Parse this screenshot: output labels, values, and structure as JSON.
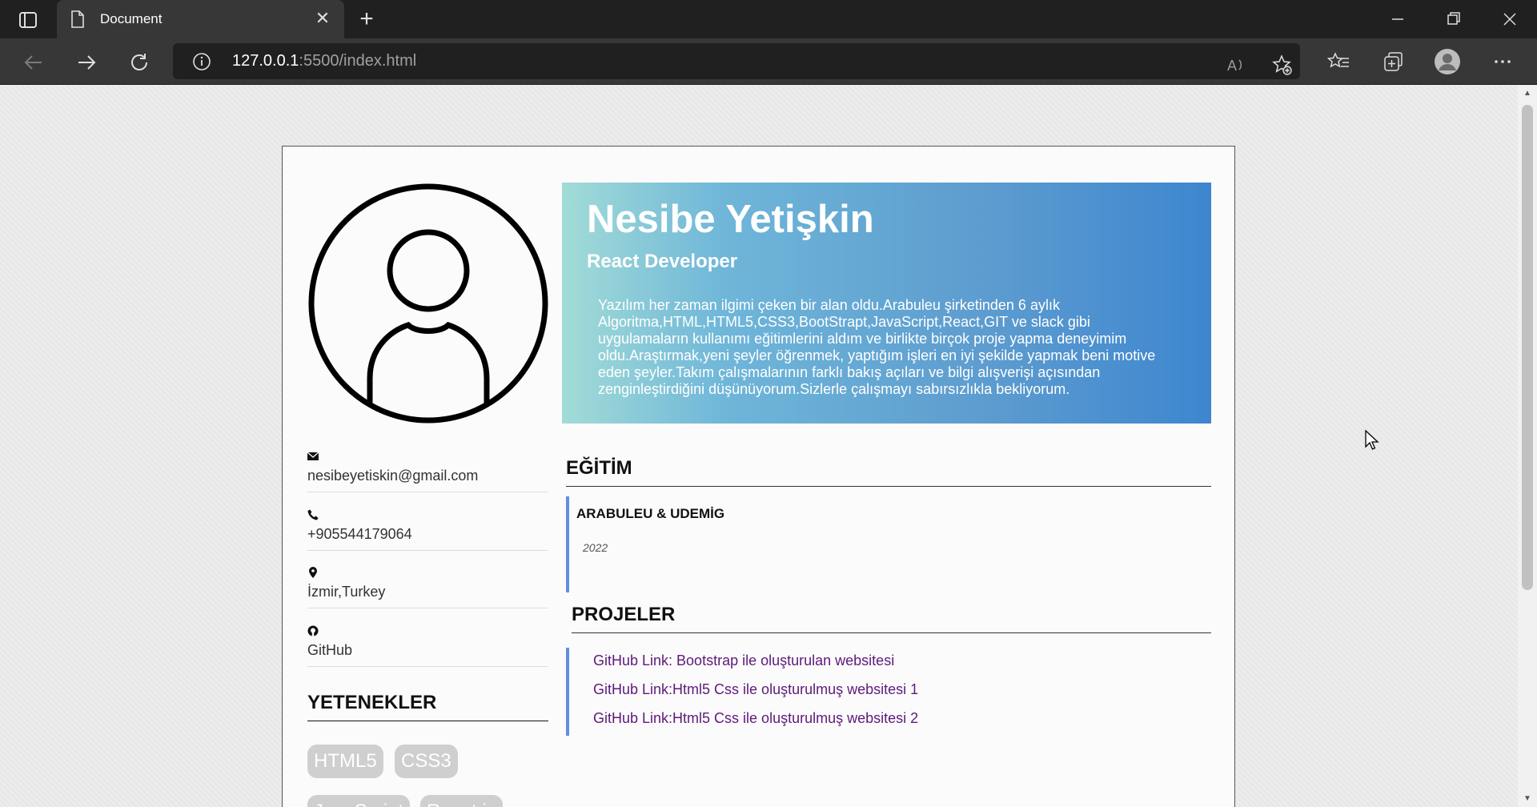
{
  "browser": {
    "tab_title": "Document",
    "tab_close": "✕",
    "new_tab": "+",
    "url_host": "127.0.0.1",
    "url_rest": ":5500/index.html"
  },
  "profile": {
    "name": "Nesibe Yetişkin",
    "role": "React Developer",
    "about": "Yazılım her zaman ilgimi çeken bir alan oldu.Arabuleu şirketinden 6 aylık Algoritma,HTML,HTML5,CSS3,BootStrapt,JavaScript,React,GIT ve slack gibi uygulamaların kullanımı eğitimlerini aldım ve birlikte birçok proje yapma deneyimim oldu.Araştırmak,yeni şeyler öğrenmek, yaptığım işleri en iyi şekilde yapmak beni motive eden şeyler.Takım çalışmalarının farklı bakış açıları ve bilgi alışverişi açısından zenginleştirdiğini düşünüyorum.Sizlerle çalışmayı sabırsızlıkla bekliyorum."
  },
  "contact": {
    "email": "nesibeyetiskin@gmail.com",
    "phone": "+905544179064",
    "location": "İzmir,Turkey",
    "github": "GitHub"
  },
  "skills": {
    "heading": "YETENEKLER",
    "items": [
      "HTML5",
      "CSS3",
      "JavaScript",
      "React.js"
    ]
  },
  "education": {
    "heading": "EĞİTİM",
    "institution": "ARABULEU & UDEMİG",
    "year": "2022"
  },
  "projects": {
    "heading": "PROJELER",
    "links": [
      "GitHub Link: Bootstrap ile oluşturulan websitesi",
      "GitHub Link:Html5 Css ile oluşturulmuş websitesi 1",
      "GitHub Link:Html5 Css ile oluşturulmuş websitesi 2"
    ]
  },
  "colors": {
    "accent": "#5f8fe0",
    "link": "#5e1a7a",
    "hero_start": "#a2dcd7",
    "hero_end": "#3d86cf"
  }
}
